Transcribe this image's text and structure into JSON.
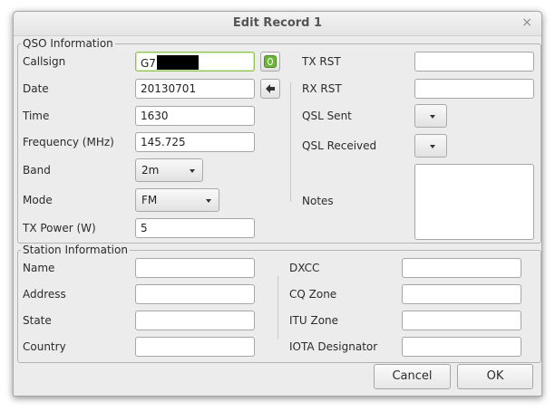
{
  "window": {
    "title": "Edit Record 1",
    "close_glyph": "×"
  },
  "qso": {
    "legend": "QSO Information",
    "callsign": {
      "label": "Callsign",
      "value": "G7"
    },
    "date": {
      "label": "Date",
      "value": "20130701"
    },
    "time": {
      "label": "Time",
      "value": "1630"
    },
    "frequency": {
      "label": "Frequency (MHz)",
      "value": "145.725"
    },
    "band": {
      "label": "Band",
      "value": "2m"
    },
    "mode": {
      "label": "Mode",
      "value": "FM"
    },
    "tx_power": {
      "label": "TX Power (W)",
      "value": "5"
    },
    "tx_rst": {
      "label": "TX RST",
      "value": ""
    },
    "rx_rst": {
      "label": "RX RST",
      "value": ""
    },
    "qsl_sent": {
      "label": "QSL Sent",
      "value": ""
    },
    "qsl_received": {
      "label": "QSL Received",
      "value": ""
    },
    "notes": {
      "label": "Notes",
      "value": ""
    }
  },
  "station": {
    "legend": "Station Information",
    "name": {
      "label": "Name",
      "value": ""
    },
    "address": {
      "label": "Address",
      "value": ""
    },
    "state": {
      "label": "State",
      "value": ""
    },
    "country": {
      "label": "Country",
      "value": ""
    },
    "dxcc": {
      "label": "DXCC",
      "value": ""
    },
    "cq_zone": {
      "label": "CQ Zone",
      "value": ""
    },
    "itu_zone": {
      "label": "ITU Zone",
      "value": ""
    },
    "iota": {
      "label": "IOTA Designator",
      "value": ""
    }
  },
  "buttons": {
    "cancel": "Cancel",
    "ok": "OK"
  },
  "icons": {
    "lookup": "info-icon",
    "arrow": "left-arrow-icon"
  },
  "colors": {
    "lookup_green": "#6fb53a",
    "focus_border": "#8fc054"
  }
}
